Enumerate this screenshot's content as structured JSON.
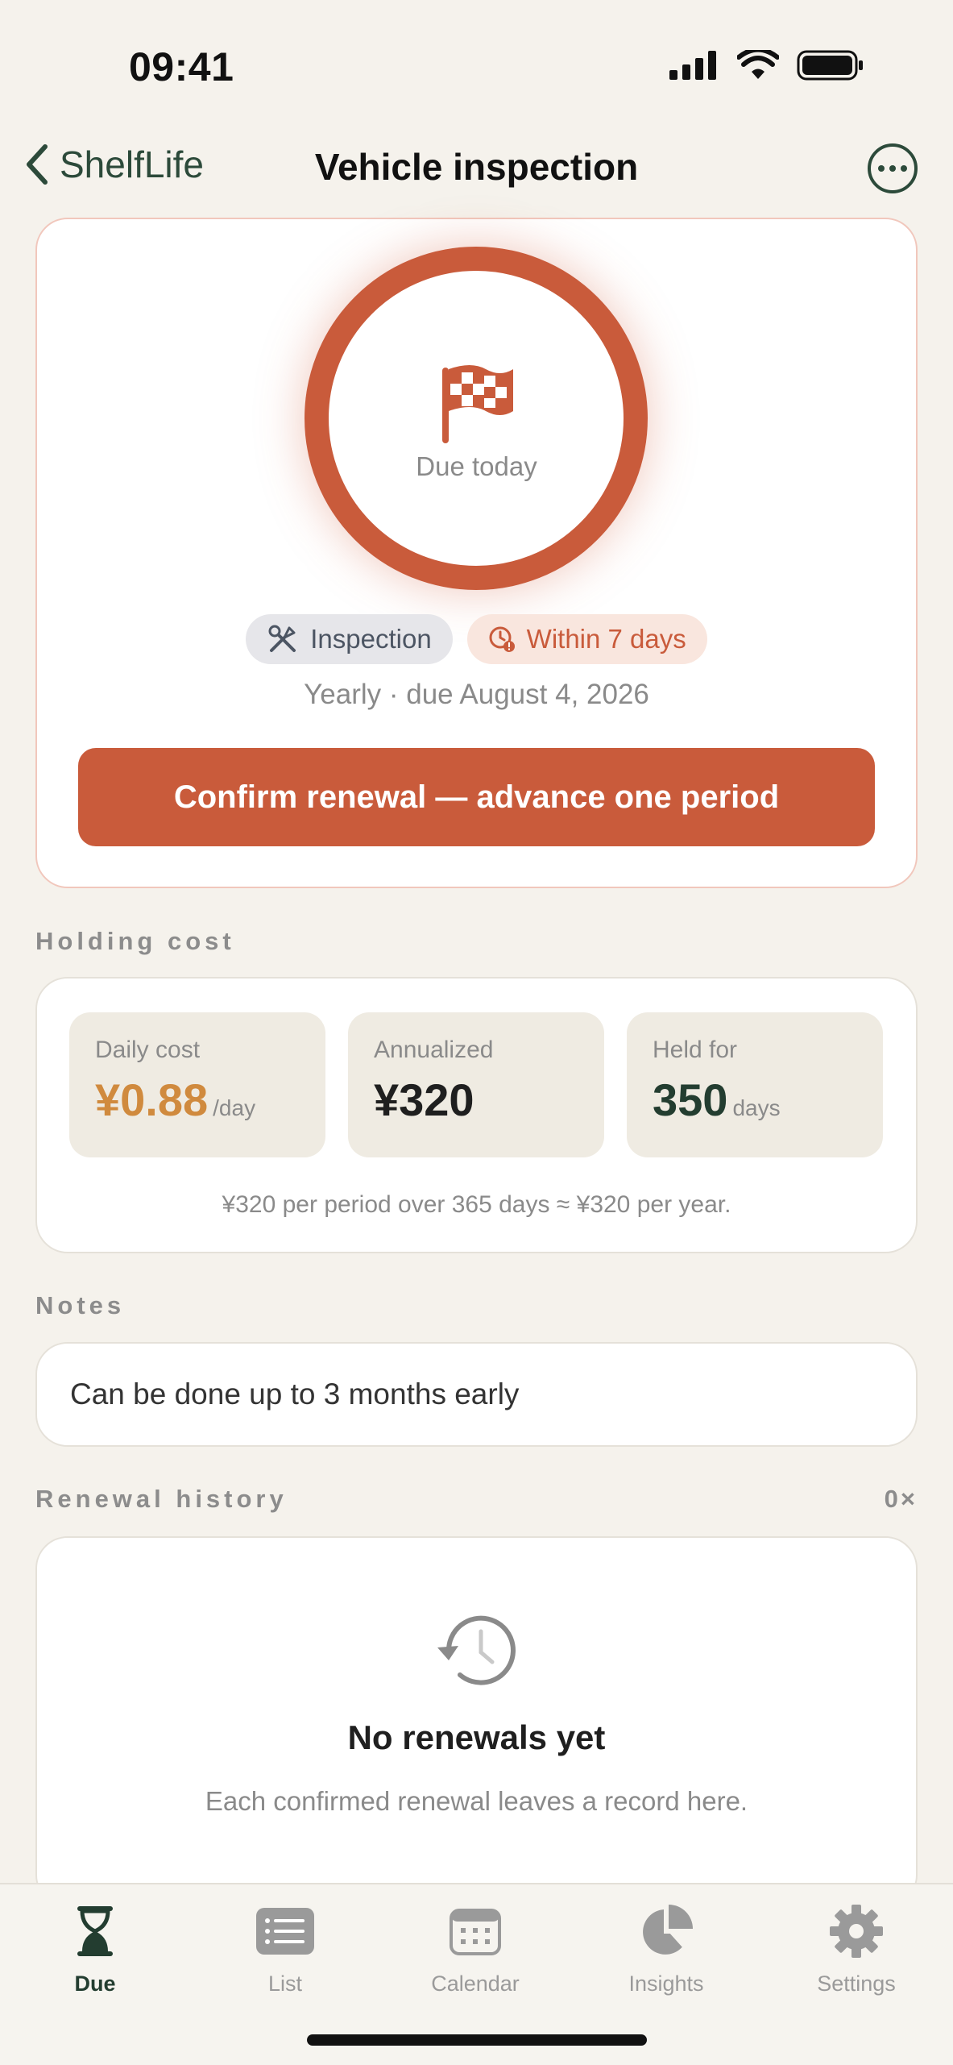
{
  "status_bar": {
    "time": "09:41"
  },
  "nav": {
    "back_label": "ShelfLife",
    "title": "Vehicle inspection"
  },
  "hero": {
    "status_text": "Due today",
    "category_chip": "Inspection",
    "urgency_chip": "Within 7 days",
    "schedule_text": "Yearly · due August 4, 2026",
    "confirm_label": "Confirm renewal — advance one period",
    "accent_color": "#C95B3B"
  },
  "holding_cost": {
    "header": "Holding cost",
    "metrics": [
      {
        "label": "Daily cost",
        "value": "¥0.88",
        "unit": "/day",
        "color": "#D08A3E"
      },
      {
        "label": "Annualized",
        "value": "¥320",
        "unit": "",
        "color": "#1F1F1F"
      },
      {
        "label": "Held for",
        "value": "350",
        "unit": "days",
        "color": "#233D30"
      }
    ],
    "footnote": "¥320 per period over 365 days ≈ ¥320 per year."
  },
  "notes": {
    "header": "Notes",
    "text": "Can be done up to 3 months early"
  },
  "renewal_history": {
    "header": "Renewal history",
    "count": "0×",
    "empty_title": "No renewals yet",
    "empty_subtitle": "Each confirmed renewal leaves a record here."
  },
  "tabs": [
    {
      "label": "Due",
      "icon": "hourglass-icon",
      "active": true
    },
    {
      "label": "List",
      "icon": "list-icon",
      "active": false
    },
    {
      "label": "Calendar",
      "icon": "calendar-icon",
      "active": false
    },
    {
      "label": "Insights",
      "icon": "pie-chart-icon",
      "active": false
    },
    {
      "label": "Settings",
      "icon": "gear-icon",
      "active": false
    }
  ]
}
